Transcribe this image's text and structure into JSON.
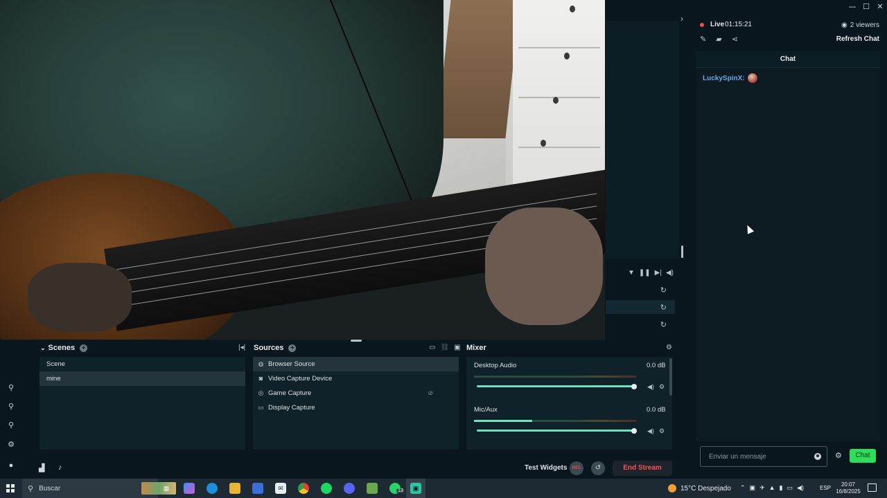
{
  "window": {
    "minimize": "—",
    "maximize": "☐",
    "close": "✕"
  },
  "stream": {
    "live_label": "Live",
    "timer": "01:15:21",
    "viewers": "2 viewers",
    "refresh_label": "Refresh Chat"
  },
  "chat": {
    "header": "Chat",
    "messages": [
      {
        "user": "LuckySpinX:"
      }
    ],
    "input_placeholder": "Enviar un mensaje",
    "send_label": "Chat"
  },
  "scenes": {
    "title": "Scenes",
    "items": [
      {
        "label": "Scene"
      },
      {
        "label": "mine"
      }
    ],
    "active_index": 1
  },
  "sources": {
    "title": "Sources",
    "items": [
      {
        "label": "Browser Source",
        "icon": "globe-icon"
      },
      {
        "label": "Video Capture Device",
        "icon": "camera-icon"
      },
      {
        "label": "Game Capture",
        "icon": "gamepad-icon"
      },
      {
        "label": "Display Capture",
        "icon": "monitor-icon"
      }
    ]
  },
  "mixer": {
    "title": "Mixer",
    "channels": [
      {
        "name": "Desktop Audio",
        "db": "0.0 dB",
        "level": 0.0,
        "volume": 1.0
      },
      {
        "name": "Mic/Aux",
        "db": "0.0 dB",
        "level": 0.36,
        "volume": 1.0
      }
    ]
  },
  "footer": {
    "test_widgets": "Test Widgets",
    "rec_label": "REC",
    "end_stream": "End Stream"
  },
  "taskbar": {
    "search_placeholder": "Buscar",
    "weather": "15°C  Despejado",
    "language": "ESP",
    "time": "20:07",
    "date": "16/8/2025",
    "whatsapp_badge": "13"
  },
  "colors": {
    "accent": "#31c3a2",
    "live": "#f14b4b",
    "send_button": "#2dde5b",
    "end_stream": "#f45454",
    "username": "#6ea6e8"
  }
}
